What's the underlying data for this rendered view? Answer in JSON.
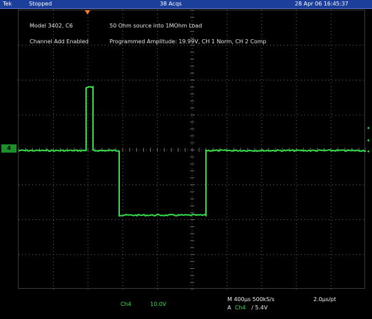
{
  "top_bar": {
    "brand": "Tek",
    "state": "Stopped",
    "acquisitions": "38 Acqs",
    "datetime": "28 Apr 06 16:45:37"
  },
  "annotations": {
    "line1_left": "Model 3402, C6",
    "line1_right": "50 Ohm source into 1MOhm Load",
    "line2_left": "Channel Add Enabled",
    "line2_right": "Programmed Amplitude: 19.99V, CH 1 Norm, CH 2 Comp"
  },
  "channel_marker": {
    "label": "4"
  },
  "bottom": {
    "channel_scale_ch": "Ch4",
    "channel_scale_value": "10.0V",
    "timebase": "M 400µs 500kS/s",
    "per_point": "2.0µs/pt",
    "trigger_prefix": "A",
    "trigger_ch": "Ch4",
    "trigger_level": "/ 5.4V"
  },
  "colors": {
    "trace": "#35e04a",
    "grid": "#6a6a6a",
    "topbar": "#1b3f9a",
    "background": "#000000"
  }
}
